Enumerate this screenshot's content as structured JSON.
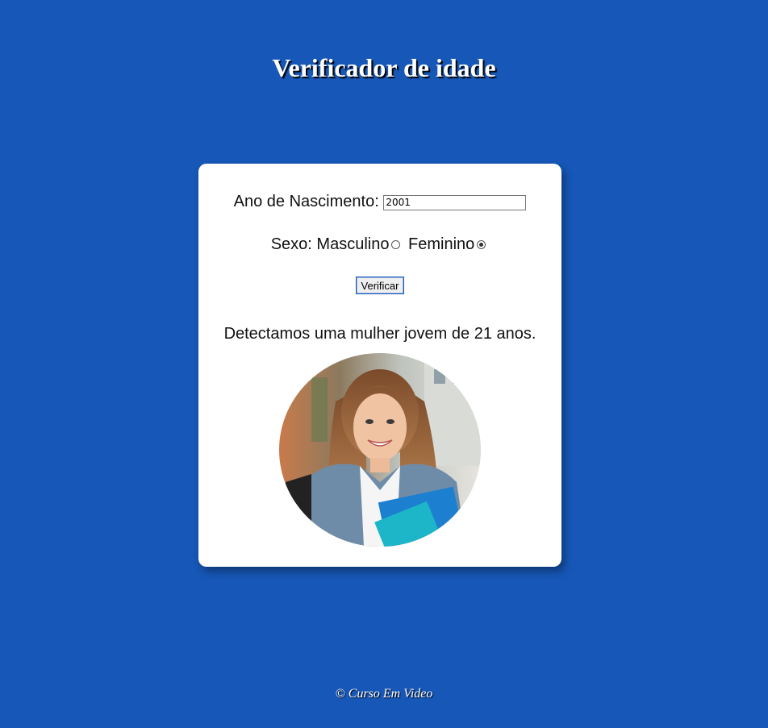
{
  "header": {
    "title": "Verificador de idade"
  },
  "form": {
    "year_label": "Ano de Nascimento:",
    "year_value": "2001",
    "sex_label": "Sexo:",
    "option_male": "Masculino",
    "option_female": "Feminino",
    "selected_option": "Feminino",
    "verify_button": "Verificar"
  },
  "result": {
    "message": "Detectamos uma mulher jovem de 21 anos.",
    "photo": "smiling-young-woman-photo"
  },
  "footer": {
    "text": "© Curso Em Video"
  },
  "colors": {
    "background": "#1657b7",
    "card": "#ffffff"
  }
}
